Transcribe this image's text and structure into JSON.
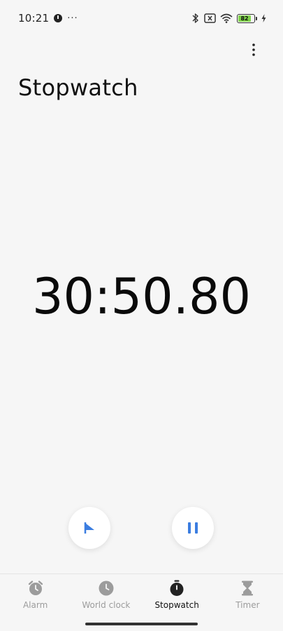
{
  "status_bar": {
    "time": "10:21",
    "more": "···",
    "battery": "82",
    "icons": [
      "clock-app-icon",
      "bluetooth-icon",
      "sim-off-icon",
      "wifi-icon",
      "battery-icon",
      "charging-icon"
    ]
  },
  "header": {
    "title": "Stopwatch",
    "menu_icon": "more-vertical-icon"
  },
  "stopwatch": {
    "elapsed": "30:50.80",
    "state": "running",
    "lap_icon": "flag-icon",
    "pause_icon": "pause-icon"
  },
  "nav": {
    "items": [
      {
        "label": "Alarm",
        "icon": "alarm-clock-icon",
        "active": false
      },
      {
        "label": "World clock",
        "icon": "clock-icon",
        "active": false
      },
      {
        "label": "Stopwatch",
        "icon": "stopwatch-icon",
        "active": true
      },
      {
        "label": "Timer",
        "icon": "hourglass-icon",
        "active": false
      }
    ]
  },
  "colors": {
    "background": "#f6f6f6",
    "accent": "#3b7de0",
    "battery_fill": "#7fd34a",
    "nav_inactive": "#9c9c9c"
  }
}
